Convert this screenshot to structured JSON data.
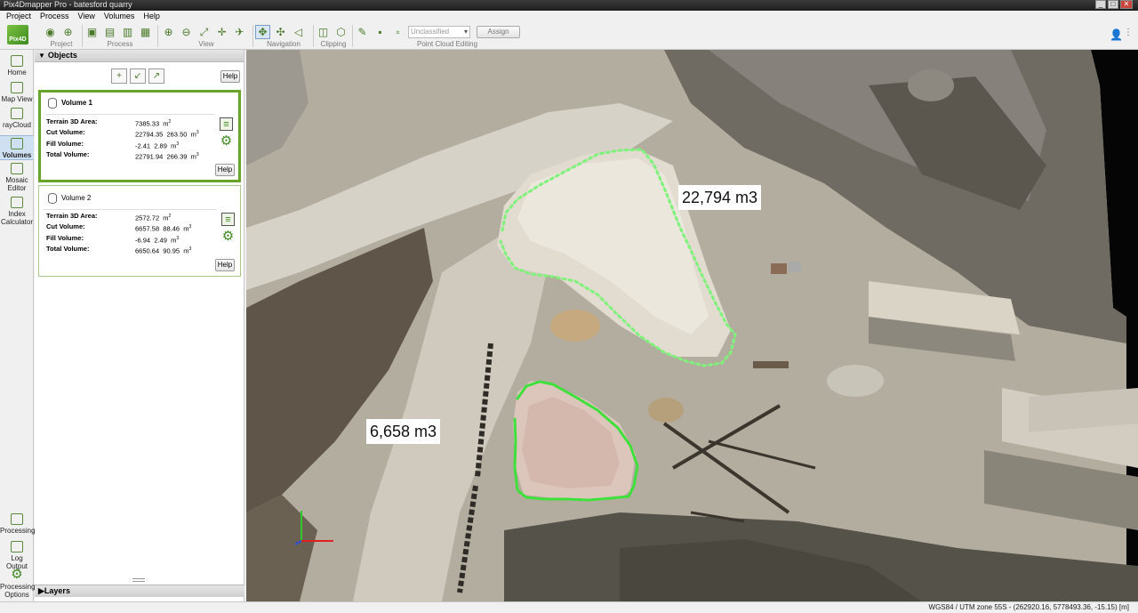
{
  "window": {
    "title": "Pix4Dmapper Pro - batesford quarry",
    "controls": [
      "_",
      "□",
      "✕"
    ]
  },
  "menu": [
    "Project",
    "Process",
    "View",
    "Volumes",
    "Help"
  ],
  "logo": {
    "text": "Pix4D"
  },
  "toolbar": {
    "groups": [
      {
        "label": "Project"
      },
      {
        "label": "Process"
      },
      {
        "label": "View"
      },
      {
        "label": "Navigation"
      },
      {
        "label": "Clipping"
      },
      {
        "label": "Point Cloud Editing"
      }
    ],
    "class_select": "Unclassified",
    "assign_label": "Assign"
  },
  "sidebar": {
    "items": [
      {
        "label": "Home",
        "icon": "home-icon"
      },
      {
        "label": "Map View",
        "icon": "map-icon"
      },
      {
        "label": "rayCloud",
        "icon": "raycloud-icon"
      },
      {
        "label": "Volumes",
        "icon": "volumes-icon",
        "active": true
      },
      {
        "label": "Mosaic Editor",
        "icon": "mosaic-icon"
      },
      {
        "label": "Index Calculator",
        "icon": "index-icon"
      }
    ],
    "bottom_items": [
      {
        "label": "Processing",
        "icon": "processing-icon"
      },
      {
        "label": "Log Output",
        "icon": "log-icon"
      },
      {
        "label": "Processing Options",
        "icon": "options-gear-icon"
      }
    ]
  },
  "objects_panel": {
    "title": "Objects",
    "help_label": "Help",
    "layers_title": "Layers",
    "volumes": [
      {
        "name": "Volume 1",
        "selected": true,
        "rows": [
          {
            "label": "Terrain 3D Area:",
            "value": "7385.33",
            "error": "",
            "unit": "m",
            "sup": "2"
          },
          {
            "label": "Cut Volume:",
            "value": "22794.35",
            "error": "263.50",
            "unit": "m",
            "sup": "3"
          },
          {
            "label": "Fill Volume:",
            "value": "-2.41",
            "error": "2.89",
            "unit": "m",
            "sup": "3"
          },
          {
            "label": "Total Volume:",
            "value": "22791.94",
            "error": "266.39",
            "unit": "m",
            "sup": "3"
          }
        ],
        "help_label": "Help"
      },
      {
        "name": "Volume 2",
        "selected": false,
        "rows": [
          {
            "label": "Terrain 3D Area:",
            "value": "2572.72",
            "error": "",
            "unit": "m",
            "sup": "2"
          },
          {
            "label": "Cut Volume:",
            "value": "6657.58",
            "error": "88.46",
            "unit": "m",
            "sup": "3"
          },
          {
            "label": "Fill Volume:",
            "value": "-6.94",
            "error": "2.49",
            "unit": "m",
            "sup": "3"
          },
          {
            "label": "Total Volume:",
            "value": "6650.64",
            "error": "90.95",
            "unit": "m",
            "sup": "3"
          }
        ],
        "help_label": "Help"
      }
    ]
  },
  "map": {
    "labels": {
      "volume1": "22,794 m3",
      "volume2": "6,658 m3"
    },
    "polygon_color": "#7ef27a",
    "polygon2_color": "#3ee03a"
  },
  "status": {
    "coords": "WGS84 / UTM zone 55S - (262920.16, 5778493.36, -15.15) [m]"
  }
}
